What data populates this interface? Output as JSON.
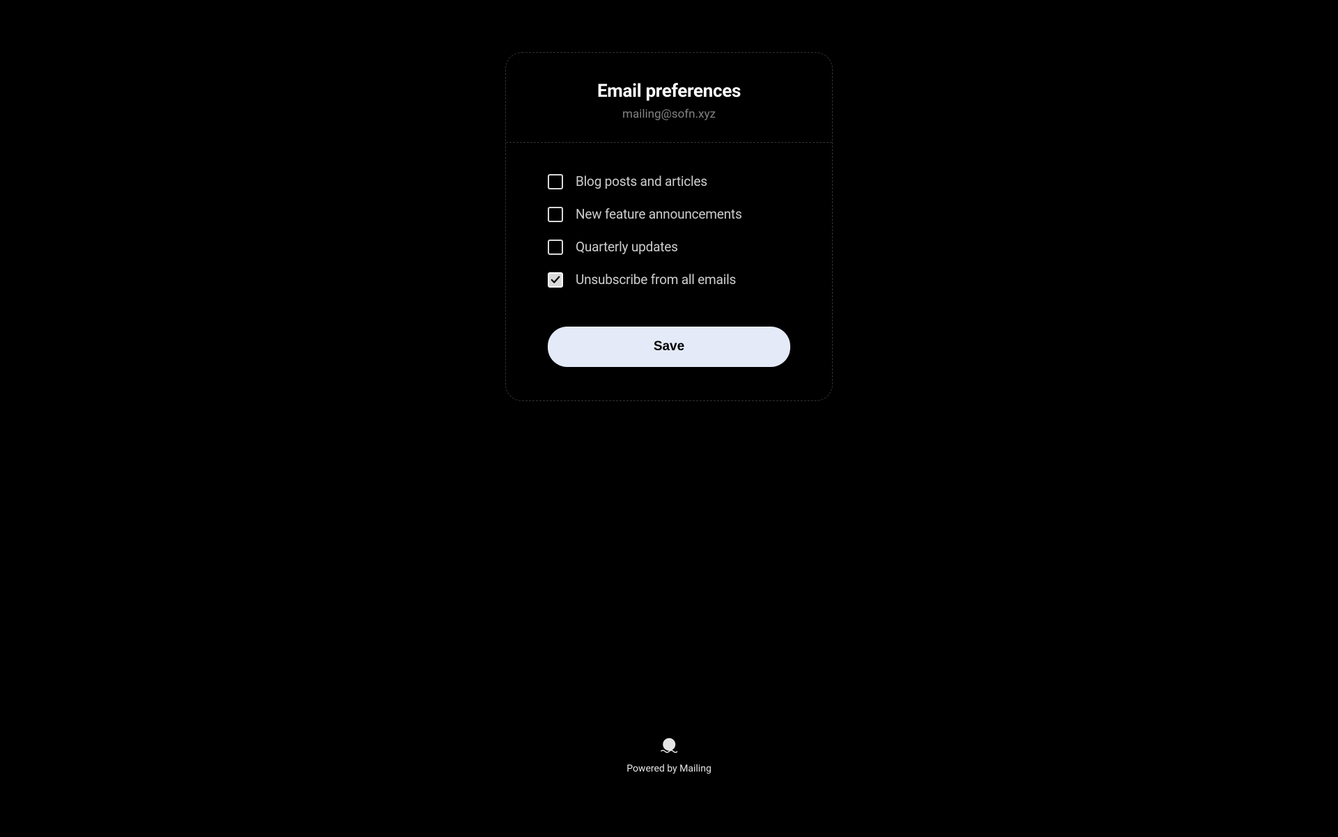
{
  "header": {
    "title": "Email preferences",
    "email": "mailing@sofn.xyz"
  },
  "options": [
    {
      "label": "Blog posts and articles",
      "checked": false
    },
    {
      "label": "New feature announcements",
      "checked": false
    },
    {
      "label": "Quarterly updates",
      "checked": false
    },
    {
      "label": "Unsubscribe from all emails",
      "checked": true
    }
  ],
  "saveButton": "Save",
  "footer": {
    "poweredBy": "Powered by Mailing"
  }
}
